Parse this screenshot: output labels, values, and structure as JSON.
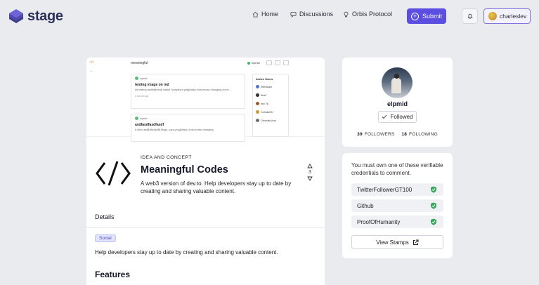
{
  "header": {
    "logo_text": "stage",
    "nav": [
      {
        "label": "Home",
        "icon": "home-icon"
      },
      {
        "label": "Discussions",
        "icon": "chat-icon"
      },
      {
        "label": "Orbis Protocol",
        "icon": "lightbulb-icon"
      }
    ],
    "submit_label": "Submit",
    "user_label": "charleslev",
    "accent_color": "#5b4ee0"
  },
  "preview": {
    "title": "meaningful",
    "user": "elpmid",
    "posts": [
      {
        "author": "elpmid",
        "title": "testing image on md",
        "body": "## testing asdfsf[elmo]f sdfsdf f playstore.png](https://urls/reuse-changing-clone ...",
        "date": "a month ago"
      },
      {
        "author": "elpmid",
        "title": "asdfasdfasdfasdf",
        "body": "# hello asdf[dfsd]sdf]f f[logo_cops.png](https://urls/codes-changing-",
        "date": ""
      }
    ],
    "active_users_title": "Active Users",
    "active_users": [
      "EffectDark",
      "AhaZ",
      "tian 🦄",
      "OxSaliuEIC",
      "OrbanianVoxs"
    ]
  },
  "post": {
    "category": "IDEA AND CONCEPT",
    "title": "Meaningful Codes",
    "description": "A web3 version of dev.to. Help developers stay up to date by creating and sharing valuable content.",
    "votes": "3",
    "details_label": "Details",
    "tag": "Social",
    "body": "Help developers stay up to date by creating and sharing valuable content.",
    "features_label": "Features"
  },
  "profile": {
    "name": "elpmid",
    "follow_label": "Followed",
    "followers_count": "39",
    "followers_label": "FOLLOWERS",
    "following_count": "18",
    "following_label": "FOLLOWING"
  },
  "credentials": {
    "message": "You must own one of these verifiable credentials to comment.",
    "items": [
      "TwitterFollowerGT100",
      "Github",
      "ProofOfHumanity"
    ],
    "stamps_label": "View Stamps",
    "shield_color": "#3aa55d"
  }
}
